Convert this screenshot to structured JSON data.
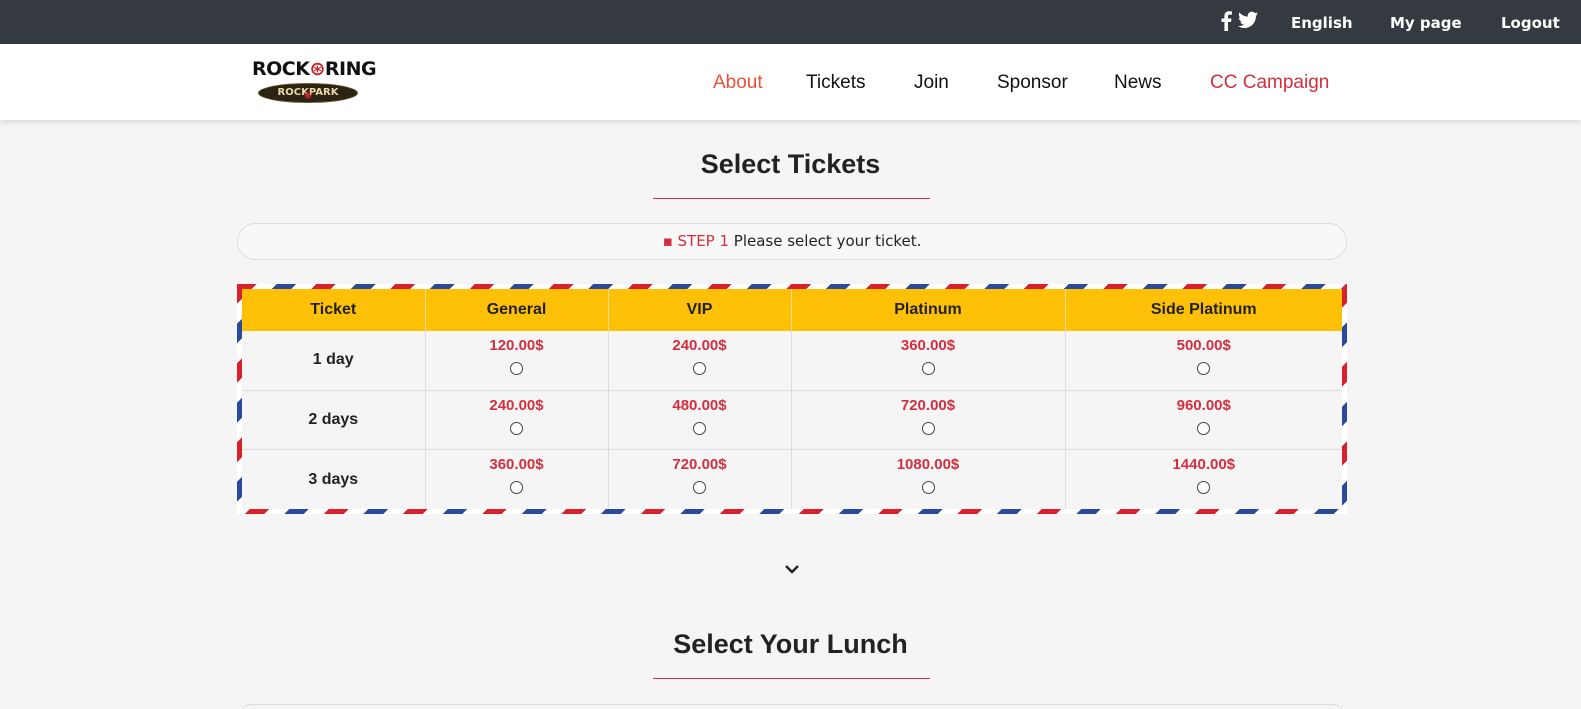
{
  "topbar": {
    "social": [
      "facebook-icon",
      "twitter-icon"
    ],
    "language": "English",
    "my_page": "My page",
    "logout": "Logout"
  },
  "logo": {
    "top_text": "ROCK RING",
    "bottom_text": "ROCK PARK"
  },
  "nav": [
    "About",
    "Tickets",
    "Join",
    "Sponsor",
    "News",
    "CC Campaign"
  ],
  "colors": {
    "accent": "#d32f3f",
    "header_yellow": "#ffc107",
    "topbar": "#343a40",
    "nav_active": "#e8503a"
  },
  "tickets": {
    "title": "Select Tickets",
    "step_prefix": "▪ STEP 1",
    "step_text": " Please select your ticket.",
    "columns": [
      "Ticket",
      "General",
      "VIP",
      "Platinum",
      "Side Platinum"
    ],
    "rows": [
      {
        "label": "1 day",
        "prices": [
          "120.00$",
          "240.00$",
          "360.00$",
          "500.00$"
        ]
      },
      {
        "label": "2 days",
        "prices": [
          "240.00$",
          "480.00$",
          "720.00$",
          "960.00$"
        ]
      },
      {
        "label": "3 days",
        "prices": [
          "360.00$",
          "720.00$",
          "1080.00$",
          "1440.00$"
        ]
      }
    ]
  },
  "lunch": {
    "title": "Select Your Lunch"
  }
}
